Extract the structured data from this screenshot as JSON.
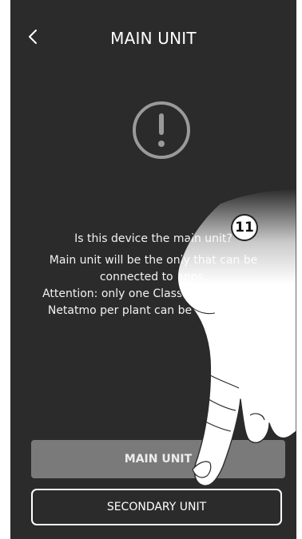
{
  "header": {
    "title": "MAIN UNIT",
    "back_icon": "chevron-left-icon"
  },
  "alert": {
    "icon": "exclamation-circle-icon"
  },
  "message": {
    "question": "Is this device the main unit?",
    "line1": "Main unit will be the only that can be",
    "line2": "connected to apps.",
    "line3": "Attention: only one Classe 300EOS with",
    "line4": "Netatmo per plant can be a main unit"
  },
  "buttons": {
    "main_label": "MAIN UNIT",
    "secondary_label": "SECONDARY UNIT"
  },
  "annotation": {
    "step_number": "11"
  },
  "colors": {
    "panel_background": "#2b2b2b",
    "main_button": "#7a7a7a",
    "icon_gray": "#9a9a9a",
    "text": "#ffffff"
  }
}
